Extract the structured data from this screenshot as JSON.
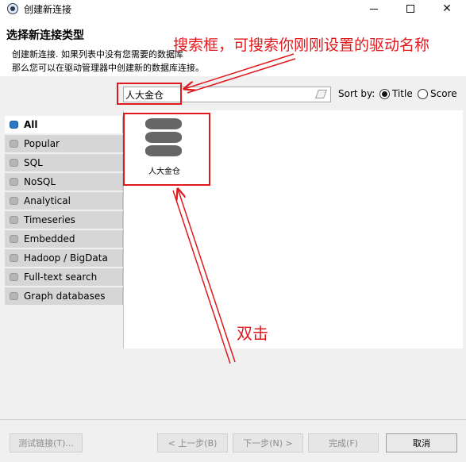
{
  "window": {
    "title": "创建新连接"
  },
  "header": {
    "title": "选择新连接类型",
    "desc_line1": "创建新连接. 如果列表中没有您需要的数据库",
    "desc_line2": "那么您可以在驱动管理器中创建新的数据库连接。"
  },
  "search": {
    "value": "人大金仓",
    "sort_label": "Sort by:",
    "sort_options": [
      "Title",
      "Score"
    ],
    "sort_selected": "Title"
  },
  "categories": [
    {
      "label": "All",
      "active": true
    },
    {
      "label": "Popular"
    },
    {
      "label": "SQL"
    },
    {
      "label": "NoSQL"
    },
    {
      "label": "Analytical"
    },
    {
      "label": "Timeseries"
    },
    {
      "label": "Embedded"
    },
    {
      "label": "Hadoop / BigData"
    },
    {
      "label": "Full-text search"
    },
    {
      "label": "Graph databases"
    }
  ],
  "drivers": [
    {
      "label": "人大金仓",
      "icon": "database-icon"
    }
  ],
  "buttons": {
    "test_connection": "测试链接(T)...",
    "back": "< 上一步(B)",
    "next": "下一步(N) >",
    "finish": "完成(F)",
    "cancel": "取消"
  },
  "annotations": {
    "search_hint": "搜索框，可搜索你刚刚设置的驱动名称",
    "double_click": "双击",
    "color": "#e0191d"
  }
}
